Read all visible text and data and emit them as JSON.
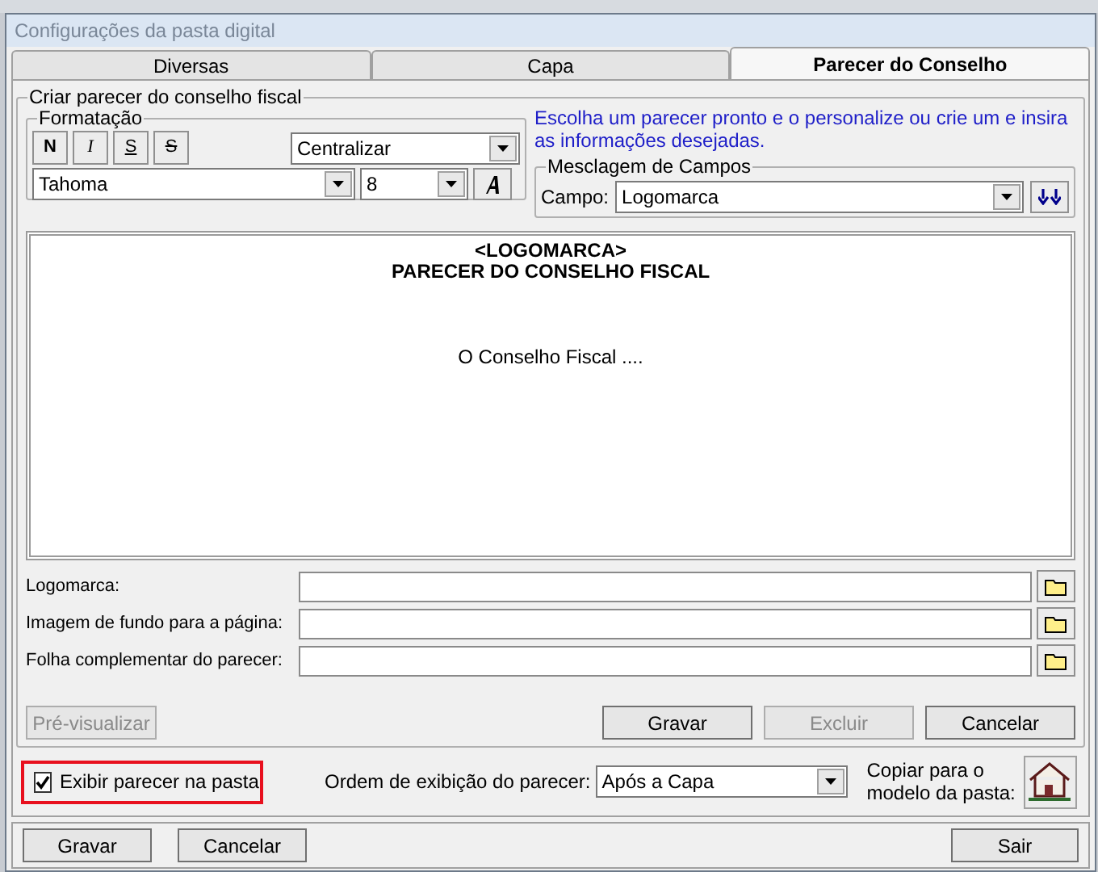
{
  "window": {
    "title": "Configurações da pasta digital"
  },
  "tabs": [
    {
      "label": "Diversas",
      "selected": false
    },
    {
      "label": "Capa",
      "selected": false
    },
    {
      "label": "Parecer do Conselho",
      "selected": true
    }
  ],
  "group_title": "Criar parecer do conselho fiscal",
  "formatting": {
    "title": "Formatação",
    "buttons": [
      {
        "label": "N",
        "kind": "bold"
      },
      {
        "label": "I",
        "kind": "italic"
      },
      {
        "label": "S",
        "kind": "underline"
      },
      {
        "label": "S",
        "kind": "strike"
      }
    ],
    "alignment": "Centralizar",
    "font": "Tahoma",
    "size": "8"
  },
  "hint": "Escolha um parecer pronto e o personalize ou crie um e insira as informações desejadas.",
  "merge": {
    "title": "Mesclagem de Campos",
    "label": "Campo:",
    "value": "Logomarca"
  },
  "editor": {
    "lines": [
      {
        "text": "<LOGOMARCA>",
        "kind": "heading"
      },
      {
        "text": "PARECER DO CONSELHO FISCAL",
        "kind": "heading"
      },
      {
        "text": "O Conselho Fiscal ....",
        "kind": "body"
      }
    ]
  },
  "files": [
    {
      "label": "Logomarca:"
    },
    {
      "label": "Imagem de fundo para a página:"
    },
    {
      "label": "Folha complementar do parecer:"
    }
  ],
  "preview_button": {
    "label": "Pré-visualizar",
    "disabled": true
  },
  "actions": [
    {
      "label": "Gravar",
      "disabled": false
    },
    {
      "label": "Excluir",
      "disabled": true
    },
    {
      "label": "Cancelar",
      "disabled": false
    }
  ],
  "show_opinion": {
    "label": "Exibir parecer na pasta",
    "checked": true
  },
  "order": {
    "label": "Ordem de exibição do parecer:",
    "value": "Após a Capa"
  },
  "copy": {
    "label": "Copiar para o modelo da pasta:"
  },
  "footer_buttons": [
    "Gravar",
    "Cancelar"
  ],
  "exit_button": "Sair"
}
